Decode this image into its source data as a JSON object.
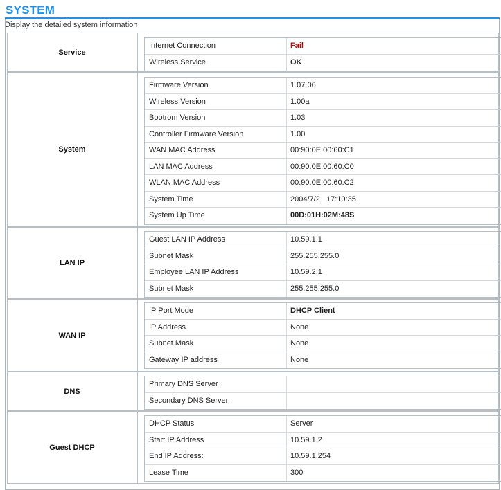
{
  "header": {
    "title": "SYSTEM",
    "description": "Display the detailed system information"
  },
  "sections": [
    {
      "label": "Service",
      "rows": [
        {
          "label": "Internet Connection",
          "value": "Fail"
        },
        {
          "label": "Wireless Service",
          "value": "OK"
        }
      ]
    },
    {
      "label": "System",
      "rows": [
        {
          "label": "Firmware Version",
          "value": "1.07.06"
        },
        {
          "label": "Wireless Version",
          "value": "1.00a"
        },
        {
          "label": "Bootrom Version",
          "value": "1.03"
        },
        {
          "label": "Controller Firmware Version",
          "value": "1.00"
        },
        {
          "label": "WAN MAC Address",
          "value": "00:90:0E:00:60:C1"
        },
        {
          "label": "LAN MAC Address",
          "value": "00:90:0E:00:60:C0"
        },
        {
          "label": "WLAN MAC Address",
          "value": "00:90:0E:00:60:C2"
        },
        {
          "label": "System Time",
          "value": "2004/7/2   17:10:35"
        },
        {
          "label": "System Up Time",
          "value": "00D:01H:02M:48S"
        }
      ]
    },
    {
      "label": "LAN IP",
      "rows": [
        {
          "label": "Guest LAN IP Address",
          "value": "10.59.1.1"
        },
        {
          "label": "Subnet Mask",
          "value": "255.255.255.0"
        },
        {
          "label": "Employee LAN IP Address",
          "value": "10.59.2.1"
        },
        {
          "label": "Subnet Mask",
          "value": "255.255.255.0"
        }
      ]
    },
    {
      "label": "WAN IP",
      "rows": [
        {
          "label": "IP Port Mode",
          "value": "DHCP Client"
        },
        {
          "label": "IP Address",
          "value": "None"
        },
        {
          "label": "Subnet Mask",
          "value": "None"
        },
        {
          "label": "Gateway IP address",
          "value": "None"
        }
      ]
    },
    {
      "label": "DNS",
      "rows": [
        {
          "label": "Primary DNS Server",
          "value": ""
        },
        {
          "label": "Secondary DNS Server",
          "value": ""
        }
      ]
    },
    {
      "label": "Guest DHCP",
      "rows": [
        {
          "label": "DHCP Status",
          "value": "Server"
        },
        {
          "label": "Start IP Address",
          "value": "10.59.1.2"
        },
        {
          "label": "End IP Address:",
          "value": "10.59.1.254"
        },
        {
          "label": "Lease Time",
          "value": "300"
        }
      ]
    }
  ],
  "colors": {
    "title": "#1e90e6",
    "fail": "#cc0000",
    "border": "#b5bfc8"
  }
}
